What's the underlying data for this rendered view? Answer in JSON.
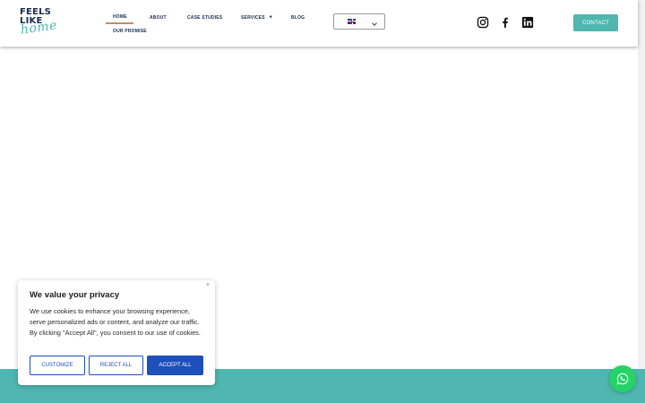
{
  "logo": {
    "line1": "FEELS",
    "line2": "LIKE",
    "line3": "home"
  },
  "nav": {
    "home": "HOME",
    "about": "ABOUT",
    "case_studies": "CASE STUDIES",
    "services": "SERVICES",
    "blog": "BLOG",
    "our_promise": "OUR PROMISE"
  },
  "language": {
    "selected_flag": "uk-flag-icon"
  },
  "social": [
    "instagram-icon",
    "facebook-icon",
    "linkedin-icon"
  ],
  "contact_label": "CONTACT",
  "cookie": {
    "title": "We value your privacy",
    "text": "We use cookies to enhance your browsing experience, serve personalized ads or content, and analyze our traffic. By clicking \"Accept All\", you consent to our use of cookies.",
    "customize": "CUSTOMIZE",
    "reject": "REJECT ALL",
    "accept": "ACCEPT ALL",
    "close_symbol": "×"
  },
  "colors": {
    "brand_navy": "#1a2a4f",
    "brand_teal": "#4fb6b0",
    "cookie_blue": "#1f4fba",
    "whatsapp_green": "#25d366",
    "active_underline": "#c48b6a"
  }
}
